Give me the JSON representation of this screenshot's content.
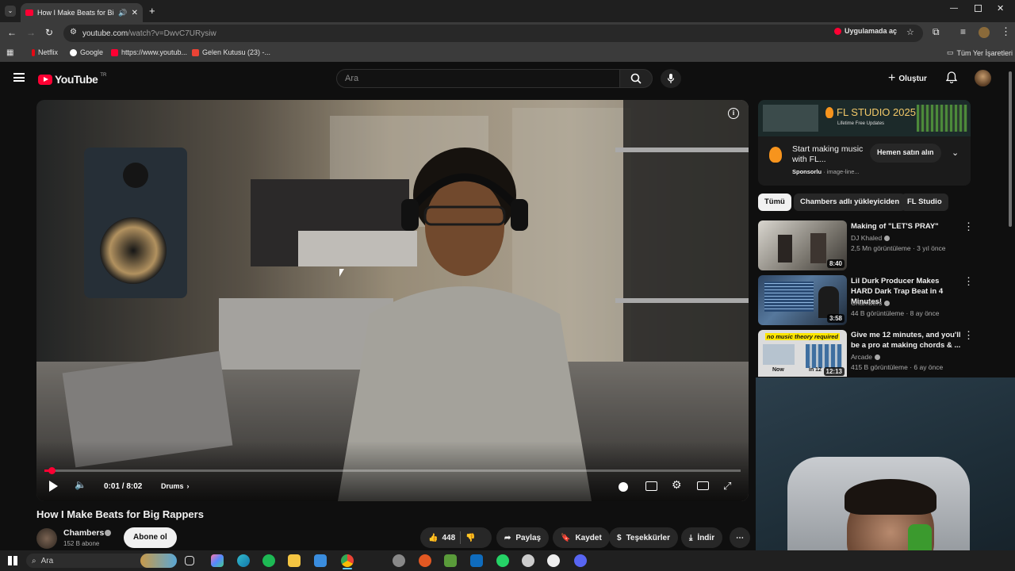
{
  "browser": {
    "tab_title": "How I Make Beats for Big R",
    "url_host": "youtube.com",
    "url_rest": "/watch?v=DwvC7URysiw",
    "open_in_app": "Uygulamada aç",
    "bookmarks": [
      "Netflix",
      "Google",
      "https://www.youtub...",
      "Gelen Kutusu (23) -..."
    ],
    "all_bookmarks": "Tüm Yer İşaretleri"
  },
  "header": {
    "logo_text": "YouTube",
    "region": "TR",
    "search_placeholder": "Ara",
    "create_label": "Oluştur"
  },
  "player": {
    "time": "0:01 / 8:02",
    "chapter": "Drums",
    "progress_fraction": 0.01
  },
  "video": {
    "title": "How I Make Beats for Big Rappers",
    "channel": "Chambers",
    "subscribers": "152 B abone",
    "subscribe_label": "Abone ol",
    "likes": "448",
    "share": "Paylaş",
    "save": "Kaydet",
    "thanks": "Teşekkürler",
    "download": "İndir"
  },
  "ad": {
    "banner_title": "FL STUDIO 2025",
    "banner_sub": "Lifetime Free Updates",
    "text": "Start making music with FL...",
    "sponsored": "Sponsorlu",
    "domain": "· image-line...",
    "cta": "Hemen satın alın"
  },
  "chips": [
    "Tümü",
    "Chambers adlı yükleyiciden",
    "FL Studio"
  ],
  "recommendations": [
    {
      "title": "Making of \"LET'S PRAY\"",
      "channel": "DJ Khaled",
      "meta": "2,5 Mn görüntüleme · 3 yıl önce",
      "duration": "8:40"
    },
    {
      "title": "Lil Durk Producer Makes HARD Dark Trap Beat in 4 Minutes!",
      "channel": "Chambers",
      "meta": "44 B görüntüleme · 8 ay önce",
      "duration": "3:58"
    },
    {
      "title": "Give me 12 minutes, and you'll be a pro at making chords & ...",
      "channel": "Arcade",
      "meta": "415 B görüntüleme · 6 ay önce",
      "duration": "12:13",
      "thumb_caption": "no music theory required",
      "thumb_now": "Now",
      "thumb_later": "in 12"
    }
  ],
  "taskbar": {
    "search_label": "Ara"
  },
  "colors": {
    "yt_red": "#ff0033",
    "bg": "#0f0f0f",
    "surface": "#272727"
  }
}
